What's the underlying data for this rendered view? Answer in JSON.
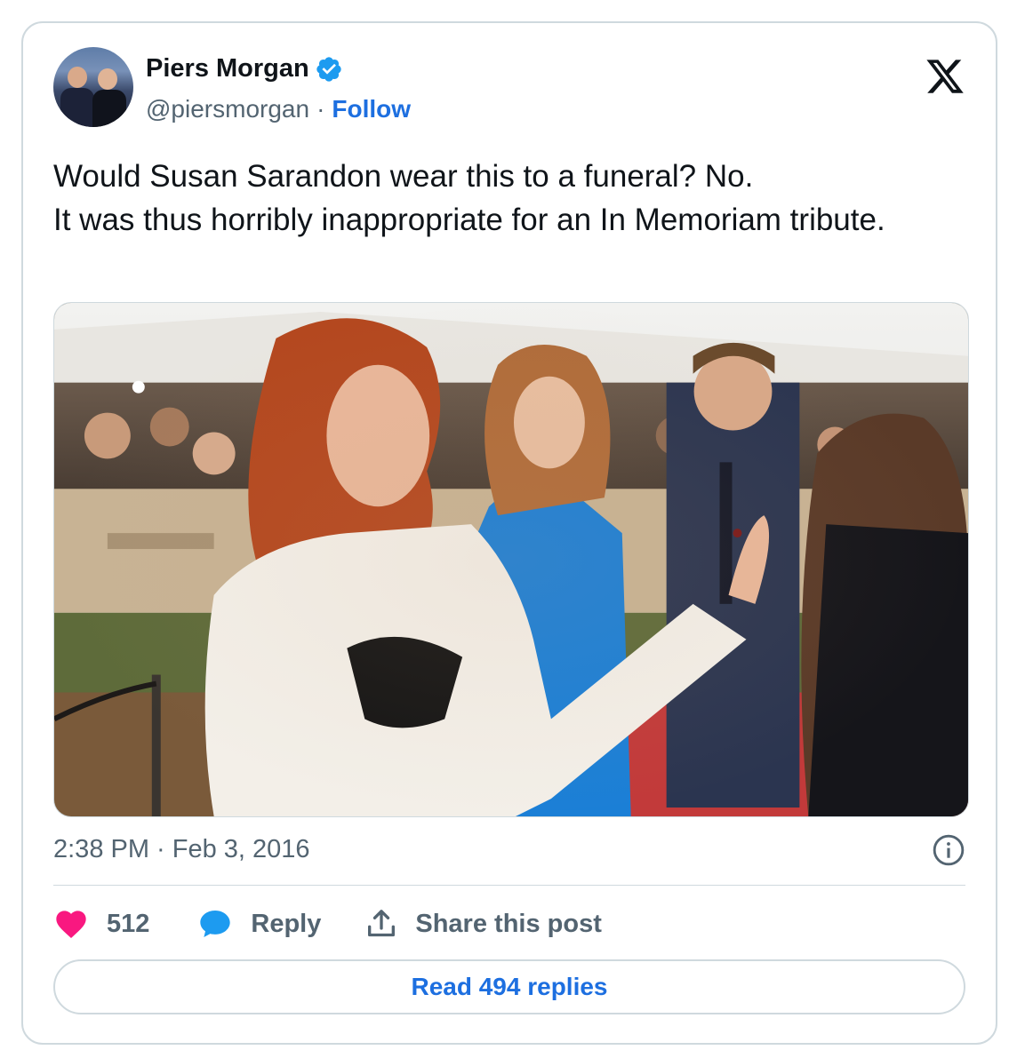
{
  "author": {
    "name": "Piers Morgan",
    "handle": "@piersmorgan",
    "separator": "·",
    "follow_label": "Follow",
    "verified": true
  },
  "brand": {
    "logo": "x-logo-icon"
  },
  "tweet": {
    "lines": [
      "Would Susan Sarandon wear this to a funeral? No.",
      "It was thus horribly inappropriate for an In Memoriam tribute."
    ],
    "media": {
      "alt": ""
    }
  },
  "meta": {
    "timestamp": "2:38 PM · Feb 3, 2016",
    "info_icon": "info-icon"
  },
  "actions": {
    "like_count": "512",
    "reply_label": "Reply",
    "share_label": "Share this post"
  },
  "read_replies_label": "Read 494 replies",
  "colors": {
    "accent": "#1d6fe0",
    "like": "#f91880",
    "reply": "#1d9bf0",
    "verified": "#1d9bf0",
    "border": "#cfd9de",
    "muted": "#536471"
  }
}
